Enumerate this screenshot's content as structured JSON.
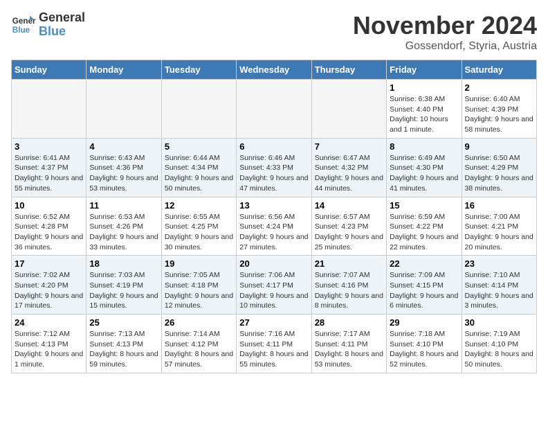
{
  "logo": {
    "line1": "General",
    "line2": "Blue"
  },
  "title": "November 2024",
  "location": "Gossendorf, Styria, Austria",
  "days_of_week": [
    "Sunday",
    "Monday",
    "Tuesday",
    "Wednesday",
    "Thursday",
    "Friday",
    "Saturday"
  ],
  "weeks": [
    [
      {
        "day": "",
        "detail": ""
      },
      {
        "day": "",
        "detail": ""
      },
      {
        "day": "",
        "detail": ""
      },
      {
        "day": "",
        "detail": ""
      },
      {
        "day": "",
        "detail": ""
      },
      {
        "day": "1",
        "detail": "Sunrise: 6:38 AM\nSunset: 4:40 PM\nDaylight: 10 hours and 1 minute."
      },
      {
        "day": "2",
        "detail": "Sunrise: 6:40 AM\nSunset: 4:39 PM\nDaylight: 9 hours and 58 minutes."
      }
    ],
    [
      {
        "day": "3",
        "detail": "Sunrise: 6:41 AM\nSunset: 4:37 PM\nDaylight: 9 hours and 55 minutes."
      },
      {
        "day": "4",
        "detail": "Sunrise: 6:43 AM\nSunset: 4:36 PM\nDaylight: 9 hours and 53 minutes."
      },
      {
        "day": "5",
        "detail": "Sunrise: 6:44 AM\nSunset: 4:34 PM\nDaylight: 9 hours and 50 minutes."
      },
      {
        "day": "6",
        "detail": "Sunrise: 6:46 AM\nSunset: 4:33 PM\nDaylight: 9 hours and 47 minutes."
      },
      {
        "day": "7",
        "detail": "Sunrise: 6:47 AM\nSunset: 4:32 PM\nDaylight: 9 hours and 44 minutes."
      },
      {
        "day": "8",
        "detail": "Sunrise: 6:49 AM\nSunset: 4:30 PM\nDaylight: 9 hours and 41 minutes."
      },
      {
        "day": "9",
        "detail": "Sunrise: 6:50 AM\nSunset: 4:29 PM\nDaylight: 9 hours and 38 minutes."
      }
    ],
    [
      {
        "day": "10",
        "detail": "Sunrise: 6:52 AM\nSunset: 4:28 PM\nDaylight: 9 hours and 36 minutes."
      },
      {
        "day": "11",
        "detail": "Sunrise: 6:53 AM\nSunset: 4:26 PM\nDaylight: 9 hours and 33 minutes."
      },
      {
        "day": "12",
        "detail": "Sunrise: 6:55 AM\nSunset: 4:25 PM\nDaylight: 9 hours and 30 minutes."
      },
      {
        "day": "13",
        "detail": "Sunrise: 6:56 AM\nSunset: 4:24 PM\nDaylight: 9 hours and 27 minutes."
      },
      {
        "day": "14",
        "detail": "Sunrise: 6:57 AM\nSunset: 4:23 PM\nDaylight: 9 hours and 25 minutes."
      },
      {
        "day": "15",
        "detail": "Sunrise: 6:59 AM\nSunset: 4:22 PM\nDaylight: 9 hours and 22 minutes."
      },
      {
        "day": "16",
        "detail": "Sunrise: 7:00 AM\nSunset: 4:21 PM\nDaylight: 9 hours and 20 minutes."
      }
    ],
    [
      {
        "day": "17",
        "detail": "Sunrise: 7:02 AM\nSunset: 4:20 PM\nDaylight: 9 hours and 17 minutes."
      },
      {
        "day": "18",
        "detail": "Sunrise: 7:03 AM\nSunset: 4:19 PM\nDaylight: 9 hours and 15 minutes."
      },
      {
        "day": "19",
        "detail": "Sunrise: 7:05 AM\nSunset: 4:18 PM\nDaylight: 9 hours and 12 minutes."
      },
      {
        "day": "20",
        "detail": "Sunrise: 7:06 AM\nSunset: 4:17 PM\nDaylight: 9 hours and 10 minutes."
      },
      {
        "day": "21",
        "detail": "Sunrise: 7:07 AM\nSunset: 4:16 PM\nDaylight: 9 hours and 8 minutes."
      },
      {
        "day": "22",
        "detail": "Sunrise: 7:09 AM\nSunset: 4:15 PM\nDaylight: 9 hours and 6 minutes."
      },
      {
        "day": "23",
        "detail": "Sunrise: 7:10 AM\nSunset: 4:14 PM\nDaylight: 9 hours and 3 minutes."
      }
    ],
    [
      {
        "day": "24",
        "detail": "Sunrise: 7:12 AM\nSunset: 4:13 PM\nDaylight: 9 hours and 1 minute."
      },
      {
        "day": "25",
        "detail": "Sunrise: 7:13 AM\nSunset: 4:13 PM\nDaylight: 8 hours and 59 minutes."
      },
      {
        "day": "26",
        "detail": "Sunrise: 7:14 AM\nSunset: 4:12 PM\nDaylight: 8 hours and 57 minutes."
      },
      {
        "day": "27",
        "detail": "Sunrise: 7:16 AM\nSunset: 4:11 PM\nDaylight: 8 hours and 55 minutes."
      },
      {
        "day": "28",
        "detail": "Sunrise: 7:17 AM\nSunset: 4:11 PM\nDaylight: 8 hours and 53 minutes."
      },
      {
        "day": "29",
        "detail": "Sunrise: 7:18 AM\nSunset: 4:10 PM\nDaylight: 8 hours and 52 minutes."
      },
      {
        "day": "30",
        "detail": "Sunrise: 7:19 AM\nSunset: 4:10 PM\nDaylight: 8 hours and 50 minutes."
      }
    ]
  ]
}
